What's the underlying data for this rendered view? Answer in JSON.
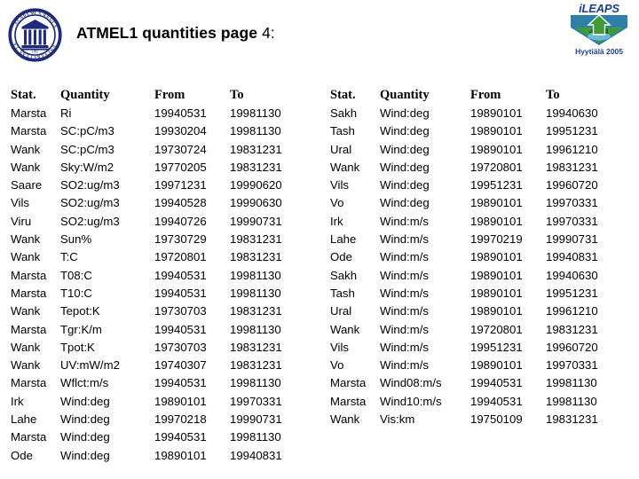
{
  "header": {
    "title_strong": "ATMEL1 quantities page",
    "title_plain": " 4:",
    "seal_name": "university-seal",
    "ileaps_wordmark": "iLEAPS",
    "ileaps_caption": "Hyytiälä 2005",
    "colors": {
      "seal_navy": "#1f2a78",
      "ileaps_blue": "#1b3f8f",
      "ileaps_green": "#3f9b35",
      "ileaps_teal": "#2f7fa8"
    }
  },
  "tables": [
    {
      "id": "left",
      "columns": [
        "Stat.",
        "Quantity",
        "From",
        "To"
      ],
      "rows": [
        [
          "Marsta",
          "Ri",
          "19940531",
          "19981130"
        ],
        [
          "Marsta",
          "SC:pC/m3",
          "19930204",
          "19981130"
        ],
        [
          "Wank",
          "SC:pC/m3",
          "19730724",
          "19831231"
        ],
        [
          "Wank",
          "Sky:W/m2",
          "19770205",
          "19831231"
        ],
        [
          "Saare",
          "SO2:ug/m3",
          "19971231",
          "19990620"
        ],
        [
          "Vils",
          "SO2:ug/m3",
          "19940528",
          "19990630"
        ],
        [
          "Viru",
          "SO2:ug/m3",
          "19940726",
          "19990731"
        ],
        [
          "Wank",
          "Sun%",
          "19730729",
          "19831231"
        ],
        [
          "Wank",
          "T:C",
          "19720801",
          "19831231"
        ],
        [
          "Marsta",
          "T08:C",
          "19940531",
          "19981130"
        ],
        [
          "Marsta",
          "T10:C",
          "19940531",
          "19981130"
        ],
        [
          "Wank",
          "Tepot:K",
          "19730703",
          "19831231"
        ],
        [
          "Marsta",
          "Tgr:K/m",
          "19940531",
          "19981130"
        ],
        [
          "Wank",
          "Tpot:K",
          "19730703",
          "19831231"
        ],
        [
          "Wank",
          "UV:mW/m2",
          "19740307",
          "19831231"
        ],
        [
          "Marsta",
          "Wflct:m/s",
          "19940531",
          "19981130"
        ],
        [
          "Irk",
          "Wind:deg",
          "19890101",
          "19970331"
        ],
        [
          "Lahe",
          "Wind:deg",
          "19970218",
          "19990731"
        ],
        [
          "Marsta",
          "Wind:deg",
          "19940531",
          "19981130"
        ],
        [
          "Ode",
          "Wind:deg",
          "19890101",
          "19940831"
        ]
      ]
    },
    {
      "id": "right",
      "columns": [
        "Stat.",
        "Quantity",
        "From",
        "To"
      ],
      "rows": [
        [
          "Sakh",
          "Wind:deg",
          "19890101",
          "19940630"
        ],
        [
          "Tash",
          "Wind:deg",
          "19890101",
          "19951231"
        ],
        [
          "Ural",
          "Wind:deg",
          "19890101",
          "19961210"
        ],
        [
          "Wank",
          "Wind:deg",
          "19720801",
          "19831231"
        ],
        [
          "Vils",
          "Wind:deg",
          "19951231",
          "19960720"
        ],
        [
          "Vo",
          "Wind:deg",
          "19890101",
          "19970331"
        ],
        [
          "Irk",
          "Wind:m/s",
          "19890101",
          "19970331"
        ],
        [
          "Lahe",
          "Wind:m/s",
          "19970219",
          "19990731"
        ],
        [
          "Ode",
          "Wind:m/s",
          "19890101",
          "19940831"
        ],
        [
          "Sakh",
          "Wind:m/s",
          "19890101",
          "19940630"
        ],
        [
          "Tash",
          "Wind:m/s",
          "19890101",
          "19951231"
        ],
        [
          "Ural",
          "Wind:m/s",
          "19890101",
          "19961210"
        ],
        [
          "Wank",
          "Wind:m/s",
          "19720801",
          "19831231"
        ],
        [
          "Vils",
          "Wind:m/s",
          "19951231",
          "19960720"
        ],
        [
          "Vo",
          "Wind:m/s",
          "19890101",
          "19970331"
        ],
        [
          "Marsta",
          "Wind08:m/s",
          "19940531",
          "19981130"
        ],
        [
          "Marsta",
          "Wind10:m/s",
          "19940531",
          "19981130"
        ],
        [
          "Wank",
          "Vis:km",
          "19750109",
          "19831231"
        ]
      ]
    }
  ]
}
